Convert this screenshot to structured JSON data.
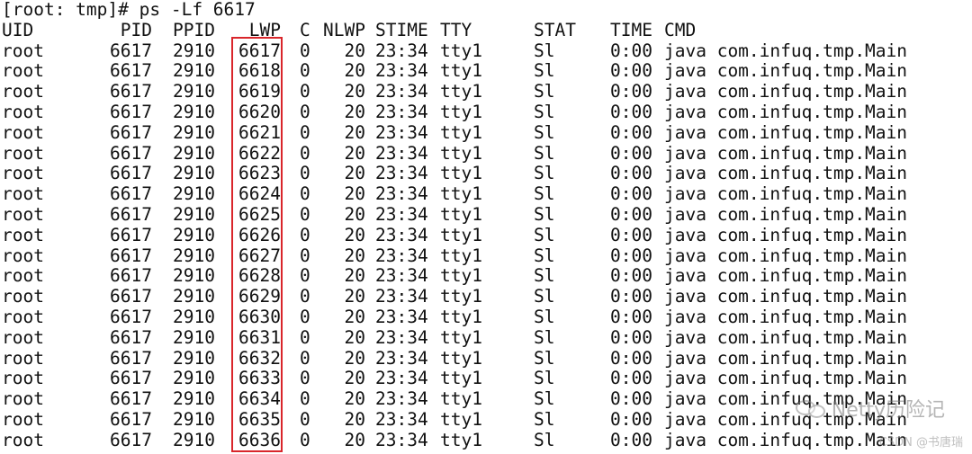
{
  "prompt": "[root: tmp]# ps -Lf 6617",
  "headers": [
    "UID",
    "PID",
    "PPID",
    "LWP",
    "C",
    "NLWP",
    "STIME",
    "TTY",
    "STAT",
    "TIME",
    "CMD"
  ],
  "rows": [
    [
      "root",
      "6617",
      "2910",
      "6617",
      "0",
      "20",
      "23:34",
      "tty1",
      "Sl",
      "0:00",
      "java com.infuq.tmp.Main"
    ],
    [
      "root",
      "6617",
      "2910",
      "6618",
      "0",
      "20",
      "23:34",
      "tty1",
      "Sl",
      "0:00",
      "java com.infuq.tmp.Main"
    ],
    [
      "root",
      "6617",
      "2910",
      "6619",
      "0",
      "20",
      "23:34",
      "tty1",
      "Sl",
      "0:00",
      "java com.infuq.tmp.Main"
    ],
    [
      "root",
      "6617",
      "2910",
      "6620",
      "0",
      "20",
      "23:34",
      "tty1",
      "Sl",
      "0:00",
      "java com.infuq.tmp.Main"
    ],
    [
      "root",
      "6617",
      "2910",
      "6621",
      "0",
      "20",
      "23:34",
      "tty1",
      "Sl",
      "0:00",
      "java com.infuq.tmp.Main"
    ],
    [
      "root",
      "6617",
      "2910",
      "6622",
      "0",
      "20",
      "23:34",
      "tty1",
      "Sl",
      "0:00",
      "java com.infuq.tmp.Main"
    ],
    [
      "root",
      "6617",
      "2910",
      "6623",
      "0",
      "20",
      "23:34",
      "tty1",
      "Sl",
      "0:00",
      "java com.infuq.tmp.Main"
    ],
    [
      "root",
      "6617",
      "2910",
      "6624",
      "0",
      "20",
      "23:34",
      "tty1",
      "Sl",
      "0:00",
      "java com.infuq.tmp.Main"
    ],
    [
      "root",
      "6617",
      "2910",
      "6625",
      "0",
      "20",
      "23:34",
      "tty1",
      "Sl",
      "0:00",
      "java com.infuq.tmp.Main"
    ],
    [
      "root",
      "6617",
      "2910",
      "6626",
      "0",
      "20",
      "23:34",
      "tty1",
      "Sl",
      "0:00",
      "java com.infuq.tmp.Main"
    ],
    [
      "root",
      "6617",
      "2910",
      "6627",
      "0",
      "20",
      "23:34",
      "tty1",
      "Sl",
      "0:00",
      "java com.infuq.tmp.Main"
    ],
    [
      "root",
      "6617",
      "2910",
      "6628",
      "0",
      "20",
      "23:34",
      "tty1",
      "Sl",
      "0:00",
      "java com.infuq.tmp.Main"
    ],
    [
      "root",
      "6617",
      "2910",
      "6629",
      "0",
      "20",
      "23:34",
      "tty1",
      "Sl",
      "0:00",
      "java com.infuq.tmp.Main"
    ],
    [
      "root",
      "6617",
      "2910",
      "6630",
      "0",
      "20",
      "23:34",
      "tty1",
      "Sl",
      "0:00",
      "java com.infuq.tmp.Main"
    ],
    [
      "root",
      "6617",
      "2910",
      "6631",
      "0",
      "20",
      "23:34",
      "tty1",
      "Sl",
      "0:00",
      "java com.infuq.tmp.Main"
    ],
    [
      "root",
      "6617",
      "2910",
      "6632",
      "0",
      "20",
      "23:34",
      "tty1",
      "Sl",
      "0:00",
      "java com.infuq.tmp.Main"
    ],
    [
      "root",
      "6617",
      "2910",
      "6633",
      "0",
      "20",
      "23:34",
      "tty1",
      "Sl",
      "0:00",
      "java com.infuq.tmp.Main"
    ],
    [
      "root",
      "6617",
      "2910",
      "6634",
      "0",
      "20",
      "23:34",
      "tty1",
      "Sl",
      "0:00",
      "java com.infuq.tmp.Main"
    ],
    [
      "root",
      "6617",
      "2910",
      "6635",
      "0",
      "20",
      "23:34",
      "tty1",
      "Sl",
      "0:00",
      "java com.infuq.tmp.Main"
    ],
    [
      "root",
      "6617",
      "2910",
      "6636",
      "0",
      "20",
      "23:34",
      "tty1",
      "Sl",
      "0:00",
      "java com.infuq.tmp.Main"
    ]
  ],
  "highlight": {
    "column": "LWP",
    "color": "#d9262b"
  },
  "watermark": {
    "text": "Netty历险记",
    "icon": "wechat-icon",
    "sub": "CSDN @书唐瑞"
  }
}
